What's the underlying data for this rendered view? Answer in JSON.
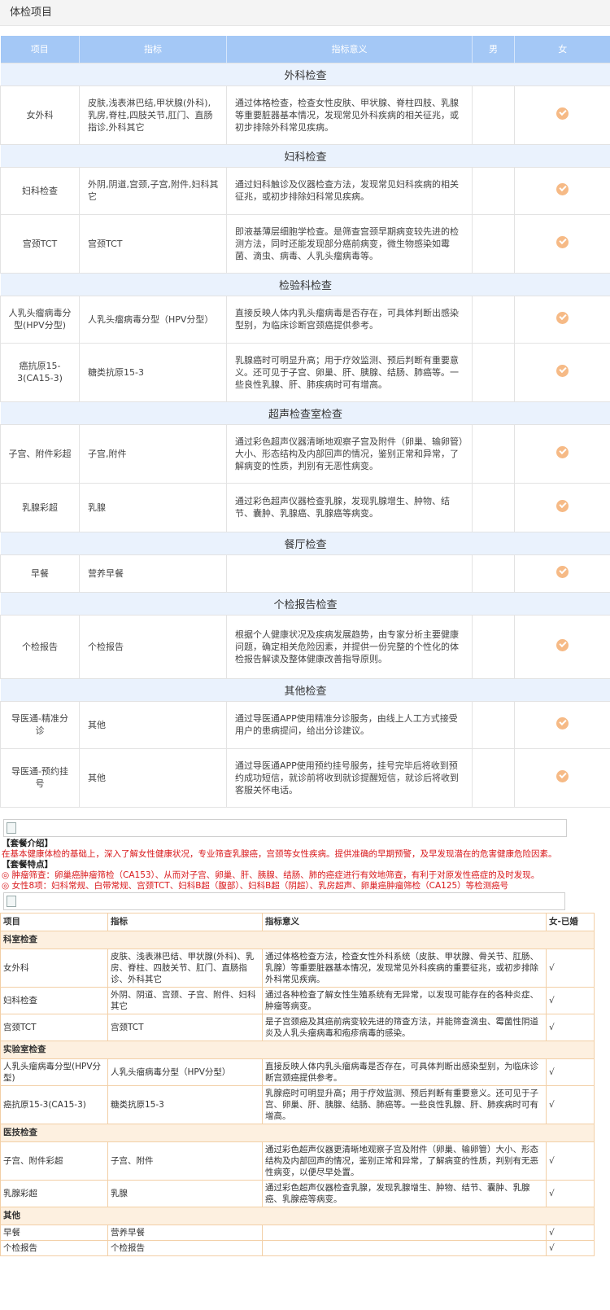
{
  "page_title": "体检项目",
  "table1": {
    "headers": [
      "项目",
      "指标",
      "指标意义",
      "男",
      "女"
    ],
    "sections": [
      {
        "title": "外科检查",
        "rows": [
          {
            "name": "女外科",
            "index": "皮肤,浅表淋巴结,甲状腺(外科),乳房,脊柱,四肢关节,肛门、直肠指诊,外科其它",
            "meaning": "通过体格检查，检查女性皮肤、甲状腺、脊柱四肢、乳腺等重要脏器基本情况，发现常见外科疾病的相关征兆，或初步排除外科常见疾病。"
          }
        ]
      },
      {
        "title": "妇科检查",
        "rows": [
          {
            "name": "妇科检查",
            "index": "外阴,阴道,宫颈,子宫,附件,妇科其它",
            "meaning": "通过妇科触诊及仪器检查方法，发现常见妇科疾病的相关征兆，或初步排除妇科常见疾病。"
          },
          {
            "name": "宫颈TCT",
            "index": "宫颈TCT",
            "meaning": "即液基薄层细胞学检查。是筛查宫颈早期病变较先进的检测方法，同时还能发现部分癌前病变，微生物感染如霉菌、滴虫、病毒、人乳头瘤病毒等。"
          }
        ]
      },
      {
        "title": "检验科检查",
        "rows": [
          {
            "name": "人乳头瘤病毒分型(HPV分型)",
            "index": "人乳头瘤病毒分型（HPV分型）",
            "meaning": "直接反映人体内乳头瘤病毒是否存在，可具体判断出感染型别，为临床诊断宫颈癌提供参考。"
          },
          {
            "name": "癌抗原15-3(CA15-3)",
            "index": "糖类抗原15-3",
            "meaning": "乳腺癌时可明显升高；用于疗效监测、预后判断有重要意义。还可见于子宫、卵巢、肝、胰腺、结肠、肺癌等。一些良性乳腺、肝、肺疾病时可有增高。"
          }
        ]
      },
      {
        "title": "超声检查室检查",
        "rows": [
          {
            "name": "子宫、附件彩超",
            "index": "子宫,附件",
            "meaning": "通过彩色超声仪器清晰地观察子宫及附件（卵巢、输卵管）大小、形态结构及内部回声的情况，鉴别正常和异常，了解病变的性质，判别有无恶性病变。"
          },
          {
            "name": "乳腺彩超",
            "index": "乳腺",
            "meaning": "通过彩色超声仪器检查乳腺，发现乳腺增生、肿物、结节、囊肿、乳腺癌、乳腺癌等病变。"
          }
        ]
      },
      {
        "title": "餐厅检查",
        "rows": [
          {
            "name": "早餐",
            "index": "营养早餐",
            "meaning": ""
          }
        ]
      },
      {
        "title": "个检报告检查",
        "rows": [
          {
            "name": "个检报告",
            "index": "个检报告",
            "meaning": "根据个人健康状况及疾病发展趋势，由专家分析主要健康问题，确定相关危险因素，并提供一份完整的个性化的体检报告解读及整体健康改善指导原则。"
          }
        ]
      },
      {
        "title": "其他检查",
        "rows": [
          {
            "name": "导医通-精准分诊",
            "index": "其他",
            "meaning": "通过导医通APP使用精准分诊服务，由线上人工方式接受用户的患病提问，给出分诊建议。"
          },
          {
            "name": "导医通-预约挂号",
            "index": "其他",
            "meaning": "通过导医通APP使用预约挂号服务，挂号完毕后将收到预约成功短信，就诊前将收到就诊提醒短信，就诊后将收到客服关怀电话。"
          }
        ]
      }
    ]
  },
  "intro": {
    "head1": "【套餐介绍】",
    "text1": "在基本健康体检的基础上，深入了解女性健康状况，专业筛查乳腺癌，宫颈等女性疾病。提供准确的早期预警，及早发现潜在的危害健康危险因素。",
    "head2": "【套餐特点】",
    "bullet1": "◎ 肿瘤筛查：卵巢癌肿瘤筛检（CA153）、从而对子宫、卵巢、肝、胰腺、结肠、肺的癌症进行有效地筛查，有利于对原发性癌症的及时发现。",
    "bullet2": "◎ 女性8项：妇科常规、白带常规、宫颈TCT、妇科B超（腹部）、妇科B超（阴超）、乳房超声、卵巢癌肿瘤筛检（CA125）等检测癌号"
  },
  "table2": {
    "headers": [
      "项目",
      "指标",
      "指标意义",
      "女-已婚"
    ],
    "mark": "√",
    "groups": [
      {
        "title": "科室检查",
        "rows": [
          {
            "name": "女外科",
            "index": "皮肤、浅表淋巴结、甲状腺(外科)、乳房、脊柱、四肢关节、肛门、直肠指诊、外科其它",
            "meaning": "通过体格检查方法，检查女性外科系统（皮肤、甲状腺、骨关节、肛肠、乳腺）等重要脏器基本情况，发现常见外科疾病的重要征兆，或初步排除外科常见疾病。"
          },
          {
            "name": "妇科检查",
            "index": "外阴、阴道、宫颈、子宫、附件、妇科其它",
            "meaning": "通过各种检查了解女性生殖系统有无异常，以发现可能存在的各种炎症、肿瘤等病变。"
          },
          {
            "name": "宫颈TCT",
            "index": "宫颈TCT",
            "meaning": "是子宫颈癌及其癌前病变较先进的筛查方法，并能筛查滴虫、霉菌性阴道炎及人乳头瘤病毒和疱疹病毒的感染。"
          }
        ]
      },
      {
        "title": "实验室检查",
        "rows": [
          {
            "name": "人乳头瘤病毒分型(HPV分型)",
            "index": "人乳头瘤病毒分型（HPV分型）",
            "meaning": "直接反映人体内乳头瘤病毒是否存在，可具体判断出感染型别，为临床诊断宫颈癌提供参考。"
          },
          {
            "name": "癌抗原15-3(CA15-3)",
            "index": "糖类抗原15-3",
            "meaning": "乳腺癌时可明显升高；用于疗效监测、预后判断有重要意义。还可见于子宫、卵巢、肝、胰腺、结肠、肺癌等。一些良性乳腺、肝、肺疾病时可有增高。"
          }
        ]
      },
      {
        "title": "医技检查",
        "rows": [
          {
            "name": "子宫、附件彩超",
            "index": "子宫、附件",
            "meaning": "通过彩色超声仪器更清晰地观察子宫及附件（卵巢、输卵管）大小、形态结构及内部回声的情况，鉴别正常和异常，了解病变的性质，判别有无恶性病变，以便尽早处置。"
          },
          {
            "name": "乳腺彩超",
            "index": "乳腺",
            "meaning": "通过彩色超声仪器检查乳腺，发现乳腺增生、肿物、结节、囊肿、乳腺癌、乳腺癌等病变。"
          }
        ]
      },
      {
        "title": "其他",
        "rows": [
          {
            "name": "早餐",
            "index": "营养早餐",
            "meaning": ""
          },
          {
            "name": "个检报告",
            "index": "个检报告",
            "meaning": ""
          }
        ]
      }
    ]
  },
  "colors": {
    "header_blue": "#a4c8f6",
    "section_blue": "#eaf2fd",
    "check_orange": "#f6ba86",
    "accent_red": "#d9191c"
  }
}
